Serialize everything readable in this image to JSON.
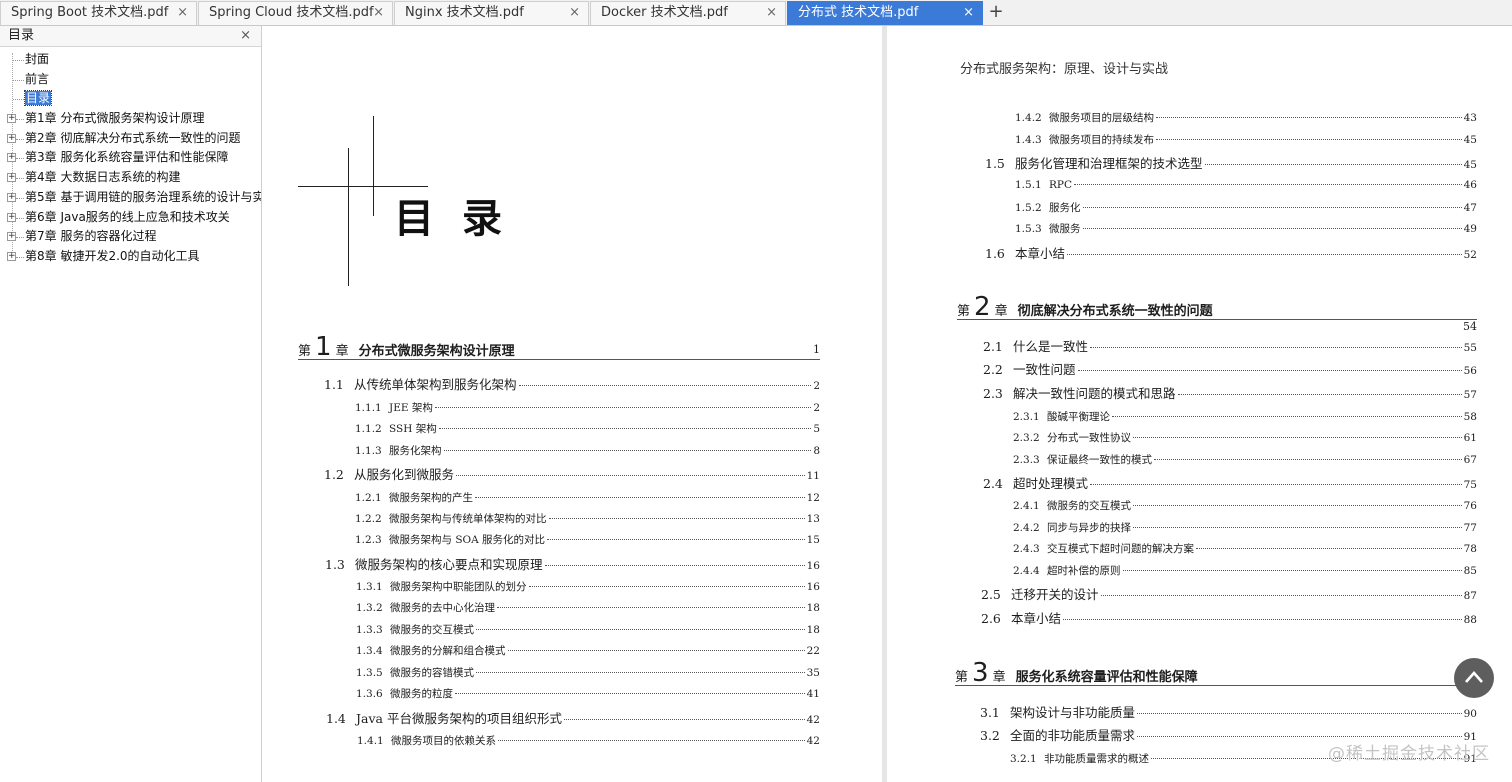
{
  "tabs": [
    {
      "label": "Spring Boot 技术文档.pdf",
      "close": "×",
      "active": false
    },
    {
      "label": "Spring Cloud 技术文档.pdf",
      "close": "×",
      "active": false
    },
    {
      "label": "Nginx 技术文档.pdf",
      "close": "×",
      "active": false
    },
    {
      "label": "Docker 技术文档.pdf",
      "close": "×",
      "active": false
    },
    {
      "label": "分布式 技术文档.pdf",
      "close": "×",
      "active": true
    }
  ],
  "new_tab": "+",
  "sidebar": {
    "title": "目录",
    "close": "×",
    "items": [
      {
        "label": "封面",
        "expandable": false
      },
      {
        "label": "前言",
        "expandable": false
      },
      {
        "label": "目录",
        "expandable": false,
        "selected": true
      },
      {
        "label": "第1章 分布式微服务架构设计原理",
        "expandable": true
      },
      {
        "label": "第2章 彻底解决分布式系统一致性的问题",
        "expandable": true
      },
      {
        "label": "第3章 服务化系统容量评估和性能保障",
        "expandable": true
      },
      {
        "label": "第4章 大数据日志系统的构建",
        "expandable": true
      },
      {
        "label": "第5章 基于调用链的服务治理系统的设计与实",
        "expandable": true
      },
      {
        "label": "第6章 Java服务的线上应急和技术攻关",
        "expandable": true
      },
      {
        "label": "第7章 服务的容器化过程",
        "expandable": true
      },
      {
        "label": "第8章 敏捷开发2.0的自动化工具",
        "expandable": true
      }
    ]
  },
  "left_page": {
    "big_title": "目录",
    "chapter1": {
      "pre": "第",
      "num": "1",
      "post": "章",
      "title": "分布式微服务架构设计原理",
      "page": "1"
    },
    "entries": [
      {
        "no": "1.1",
        "text": "从传统单体架构到服务化架构",
        "page": "2"
      },
      {
        "no": "1.1.1",
        "text": "JEE 架构",
        "page": "2"
      },
      {
        "no": "1.1.2",
        "text": "SSH 架构",
        "page": "5"
      },
      {
        "no": "1.1.3",
        "text": "服务化架构",
        "page": "8"
      },
      {
        "no": "1.2",
        "text": "从服务化到微服务",
        "page": "11"
      },
      {
        "no": "1.2.1",
        "text": "微服务架构的产生",
        "page": "12"
      },
      {
        "no": "1.2.2",
        "text": "微服务架构与传统单体架构的对比",
        "page": "13"
      },
      {
        "no": "1.2.3",
        "text": "微服务架构与 SOA 服务化的对比",
        "page": "15"
      },
      {
        "no": "1.3",
        "text": "微服务架构的核心要点和实现原理",
        "page": "16"
      },
      {
        "no": "1.3.1",
        "text": "微服务架构中职能团队的划分",
        "page": "16"
      },
      {
        "no": "1.3.2",
        "text": "微服务的去中心化治理",
        "page": "18"
      },
      {
        "no": "1.3.3",
        "text": "微服务的交互模式",
        "page": "18"
      },
      {
        "no": "1.3.4",
        "text": "微服务的分解和组合模式",
        "page": "22"
      },
      {
        "no": "1.3.5",
        "text": "微服务的容错模式",
        "page": "35"
      },
      {
        "no": "1.3.6",
        "text": "微服务的粒度",
        "page": "41"
      },
      {
        "no": "1.4",
        "text": "Java 平台微服务架构的项目组织形式",
        "page": "42"
      },
      {
        "no": "1.4.1",
        "text": "微服务项目的依赖关系",
        "page": "42"
      }
    ]
  },
  "right_page": {
    "running_head": "分布式服务架构：原理、设计与实战",
    "entries_top": [
      {
        "no": "1.4.2",
        "text": "微服务项目的层级结构",
        "page": "43"
      },
      {
        "no": "1.4.3",
        "text": "微服务项目的持续发布",
        "page": "45"
      },
      {
        "no": "1.5",
        "text": "服务化管理和治理框架的技术选型",
        "page": "45"
      },
      {
        "no": "1.5.1",
        "text": "RPC",
        "page": "46"
      },
      {
        "no": "1.5.2",
        "text": "服务化",
        "page": "47"
      },
      {
        "no": "1.5.3",
        "text": "微服务",
        "page": "49"
      },
      {
        "no": "1.6",
        "text": "本章小结",
        "page": "52"
      }
    ],
    "chapter2": {
      "pre": "第",
      "num": "2",
      "post": "章",
      "title": "彻底解决分布式系统一致性的问题",
      "page": "54"
    },
    "entries_ch2": [
      {
        "no": "2.1",
        "text": "什么是一致性",
        "page": "55"
      },
      {
        "no": "2.2",
        "text": "一致性问题",
        "page": "56"
      },
      {
        "no": "2.3",
        "text": "解决一致性问题的模式和思路",
        "page": "57"
      },
      {
        "no": "2.3.1",
        "text": "酸碱平衡理论",
        "page": "58"
      },
      {
        "no": "2.3.2",
        "text": "分布式一致性协议",
        "page": "61"
      },
      {
        "no": "2.3.3",
        "text": "保证最终一致性的模式",
        "page": "67"
      },
      {
        "no": "2.4",
        "text": "超时处理模式",
        "page": "75"
      },
      {
        "no": "2.4.1",
        "text": "微服务的交互模式",
        "page": "76"
      },
      {
        "no": "2.4.2",
        "text": "同步与异步的抉择",
        "page": "77"
      },
      {
        "no": "2.4.3",
        "text": "交互模式下超时问题的解决方案",
        "page": "78"
      },
      {
        "no": "2.4.4",
        "text": "超时补偿的原则",
        "page": "85"
      },
      {
        "no": "2.5",
        "text": "迁移开关的设计",
        "page": "87"
      },
      {
        "no": "2.6",
        "text": "本章小结",
        "page": "88"
      }
    ],
    "chapter3": {
      "pre": "第",
      "num": "3",
      "post": "章",
      "title": "服务化系统容量评估和性能保障",
      "page": ""
    },
    "entries_ch3": [
      {
        "no": "3.1",
        "text": "架构设计与非功能质量",
        "page": "90"
      },
      {
        "no": "3.2",
        "text": "全面的非功能质量需求",
        "page": "91"
      },
      {
        "no": "3.2.1",
        "text": "非功能质量需求的概述",
        "page": "91"
      }
    ]
  },
  "watermark": "@稀土掘金技术社区"
}
